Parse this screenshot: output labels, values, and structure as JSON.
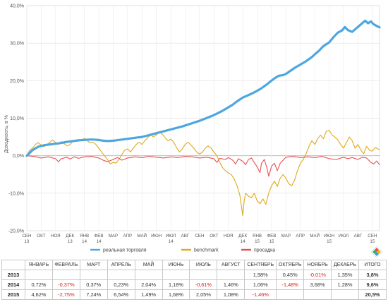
{
  "chart_data": {
    "type": "line",
    "title": "",
    "xlabel": "",
    "ylabel": "Доходность, в %",
    "ylim": [
      -20,
      40
    ],
    "y_ticks": [
      "40,0%",
      "30,0%",
      "20,0%",
      "10,0%",
      "0,0%",
      "-10,0%",
      "-20,0%"
    ],
    "y_tick_values": [
      40,
      30,
      20,
      10,
      0,
      -10,
      -20
    ],
    "grid": true,
    "legend_position": "bottom",
    "x_ticks": [
      {
        "label": "СЕН",
        "year": "13",
        "x": 0
      },
      {
        "label": "ОКТ",
        "year": "",
        "x": 1
      },
      {
        "label": "НОЯ",
        "year": "",
        "x": 2
      },
      {
        "label": "ДЕК",
        "year": "13",
        "x": 3
      },
      {
        "label": "ЯНВ",
        "year": "14",
        "x": 4
      },
      {
        "label": "ФЕВ",
        "year": "14",
        "x": 5
      },
      {
        "label": "МАР",
        "year": "",
        "x": 6
      },
      {
        "label": "АПР",
        "year": "",
        "x": 7
      },
      {
        "label": "МАЙ",
        "year": "",
        "x": 8
      },
      {
        "label": "ИЮН",
        "year": "",
        "x": 9
      },
      {
        "label": "ИЮЛ",
        "year": "14",
        "x": 10
      },
      {
        "label": "АВГ",
        "year": "",
        "x": 11
      },
      {
        "label": "СЕН",
        "year": "",
        "x": 12
      },
      {
        "label": "ОКТ",
        "year": "",
        "x": 13
      },
      {
        "label": "НОЯ",
        "year": "",
        "x": 14
      },
      {
        "label": "ДЕК",
        "year": "14",
        "x": 15
      },
      {
        "label": "ЯНВ",
        "year": "15",
        "x": 16
      },
      {
        "label": "ФЕВ",
        "year": "15",
        "x": 17
      },
      {
        "label": "МАР",
        "year": "",
        "x": 18
      },
      {
        "label": "АПР",
        "year": "",
        "x": 19
      },
      {
        "label": "МАЙ",
        "year": "",
        "x": 20
      },
      {
        "label": "ИЮН",
        "year": "15",
        "x": 21
      },
      {
        "label": "ИЮЛ",
        "year": "",
        "x": 22
      },
      {
        "label": "АВГ",
        "year": "",
        "x": 23
      },
      {
        "label": "СЕН",
        "year": "15",
        "x": 24
      }
    ],
    "x_range": [
      0,
      24.5
    ],
    "series": [
      {
        "name": "реальная торговля",
        "color": "#4da6e0",
        "width": 3.2,
        "points": [
          [
            0,
            0
          ],
          [
            0.4,
            1.5
          ],
          [
            0.8,
            2.4
          ],
          [
            1.2,
            2.8
          ],
          [
            1.6,
            3.0
          ],
          [
            2,
            3.2
          ],
          [
            2.4,
            3.4
          ],
          [
            2.8,
            3.7
          ],
          [
            3.2,
            3.9
          ],
          [
            3.6,
            4.1
          ],
          [
            4,
            4.2
          ],
          [
            4.3,
            4.3
          ],
          [
            4.6,
            4.3
          ],
          [
            5,
            4.2
          ],
          [
            5.3,
            4.0
          ],
          [
            5.6,
            3.9
          ],
          [
            6,
            4.0
          ],
          [
            6.4,
            4.2
          ],
          [
            6.8,
            4.4
          ],
          [
            7.2,
            4.6
          ],
          [
            7.6,
            4.8
          ],
          [
            8,
            5.0
          ],
          [
            8.4,
            5.4
          ],
          [
            8.8,
            5.8
          ],
          [
            9.2,
            6.2
          ],
          [
            9.6,
            6.6
          ],
          [
            10,
            7.0
          ],
          [
            10.4,
            7.4
          ],
          [
            10.8,
            7.8
          ],
          [
            11.2,
            8.3
          ],
          [
            11.6,
            8.8
          ],
          [
            12,
            9.3
          ],
          [
            12.4,
            9.9
          ],
          [
            12.8,
            10.5
          ],
          [
            13.2,
            11.2
          ],
          [
            13.6,
            12.0
          ],
          [
            14,
            12.9
          ],
          [
            14.3,
            13.6
          ],
          [
            14.6,
            14.5
          ],
          [
            15,
            15.5
          ],
          [
            15.3,
            16.0
          ],
          [
            15.6,
            16.5
          ],
          [
            16,
            17.3
          ],
          [
            16.3,
            18.0
          ],
          [
            16.6,
            18.8
          ],
          [
            17,
            20.0
          ],
          [
            17.2,
            20.6
          ],
          [
            17.5,
            21.3
          ],
          [
            17.8,
            21.5
          ],
          [
            18,
            21.8
          ],
          [
            18.3,
            22.6
          ],
          [
            18.6,
            23.4
          ],
          [
            19,
            24.3
          ],
          [
            19.4,
            25.2
          ],
          [
            19.8,
            26.3
          ],
          [
            20,
            27.0
          ],
          [
            20.3,
            28.0
          ],
          [
            20.6,
            29.2
          ],
          [
            21,
            30.2
          ],
          [
            21.3,
            31.6
          ],
          [
            21.6,
            32.8
          ],
          [
            21.9,
            33.4
          ],
          [
            22.1,
            34.3
          ],
          [
            22.3,
            33.5
          ],
          [
            22.6,
            33.0
          ],
          [
            22.9,
            34.0
          ],
          [
            23.2,
            35.0
          ],
          [
            23.5,
            36.0
          ],
          [
            23.7,
            35.3
          ],
          [
            23.9,
            35.8
          ],
          [
            24.1,
            35.0
          ],
          [
            24.3,
            34.6
          ],
          [
            24.5,
            34.2
          ]
        ]
      },
      {
        "name": "benchmark",
        "color": "#e0a81e",
        "width": 1.1,
        "points": [
          [
            0,
            0
          ],
          [
            0.2,
            1.5
          ],
          [
            0.4,
            2.0
          ],
          [
            0.6,
            3.0
          ],
          [
            0.8,
            3.5
          ],
          [
            1,
            2.8
          ],
          [
            1.2,
            2.4
          ],
          [
            1.4,
            3.0
          ],
          [
            1.6,
            3.6
          ],
          [
            1.8,
            4.2
          ],
          [
            2,
            3.5
          ],
          [
            2.2,
            3.0
          ],
          [
            2.4,
            3.8
          ],
          [
            2.6,
            3.2
          ],
          [
            2.8,
            2.6
          ],
          [
            3,
            3.0
          ],
          [
            3.2,
            3.8
          ],
          [
            3.4,
            4.2
          ],
          [
            3.6,
            4.0
          ],
          [
            3.8,
            4.2
          ],
          [
            4,
            4.6
          ],
          [
            4.2,
            4.0
          ],
          [
            4.4,
            3.4
          ],
          [
            4.6,
            3.6
          ],
          [
            4.8,
            3.0
          ],
          [
            5,
            2.0
          ],
          [
            5.2,
            1.0
          ],
          [
            5.4,
            0.0
          ],
          [
            5.6,
            -1.0
          ],
          [
            5.8,
            -2.2
          ],
          [
            6,
            -1.8
          ],
          [
            6.2,
            -2.0
          ],
          [
            6.4,
            -1.0
          ],
          [
            6.6,
            0.3
          ],
          [
            6.8,
            1.5
          ],
          [
            7,
            1.8
          ],
          [
            7.2,
            1.0
          ],
          [
            7.4,
            2.0
          ],
          [
            7.6,
            3.0
          ],
          [
            7.8,
            3.6
          ],
          [
            8,
            3.0
          ],
          [
            8.2,
            4.0
          ],
          [
            8.4,
            4.8
          ],
          [
            8.6,
            5.5
          ],
          [
            8.8,
            5.0
          ],
          [
            9,
            5.6
          ],
          [
            9.2,
            6.2
          ],
          [
            9.4,
            5.8
          ],
          [
            9.6,
            4.8
          ],
          [
            9.8,
            4.0
          ],
          [
            10,
            4.4
          ],
          [
            10.2,
            3.6
          ],
          [
            10.4,
            2.2
          ],
          [
            10.6,
            1.0
          ],
          [
            10.8,
            1.8
          ],
          [
            11,
            3.0
          ],
          [
            11.2,
            3.6
          ],
          [
            11.4,
            2.8
          ],
          [
            11.6,
            2.0
          ],
          [
            11.8,
            1.0
          ],
          [
            12,
            0.4
          ],
          [
            12.2,
            1.0
          ],
          [
            12.4,
            2.0
          ],
          [
            12.6,
            2.6
          ],
          [
            12.8,
            2.0
          ],
          [
            13,
            1.0
          ],
          [
            13.2,
            0.0
          ],
          [
            13.4,
            -1.8
          ],
          [
            13.6,
            -3.2
          ],
          [
            13.8,
            -4.0
          ],
          [
            14,
            -4.6
          ],
          [
            14.2,
            -5.0
          ],
          [
            14.4,
            -6.2
          ],
          [
            14.6,
            -8.0
          ],
          [
            14.8,
            -10.5
          ],
          [
            15,
            -16.0
          ],
          [
            15.1,
            -12.0
          ],
          [
            15.2,
            -10.0
          ],
          [
            15.4,
            -10.8
          ],
          [
            15.6,
            -11.2
          ],
          [
            15.8,
            -10.0
          ],
          [
            16,
            -12.0
          ],
          [
            16.2,
            -12.8
          ],
          [
            16.4,
            -11.5
          ],
          [
            16.6,
            -13.0
          ],
          [
            16.8,
            -10.0
          ],
          [
            17,
            -8.0
          ],
          [
            17.2,
            -6.8
          ],
          [
            17.4,
            -8.2
          ],
          [
            17.6,
            -6.0
          ],
          [
            17.8,
            -5.0
          ],
          [
            18,
            -6.0
          ],
          [
            18.2,
            -7.5
          ],
          [
            18.4,
            -8.0
          ],
          [
            18.6,
            -6.5
          ],
          [
            18.8,
            -4.0
          ],
          [
            19,
            -2.0
          ],
          [
            19.2,
            -1.0
          ],
          [
            19.4,
            0.5
          ],
          [
            19.6,
            2.5
          ],
          [
            19.8,
            4.0
          ],
          [
            20,
            3.0
          ],
          [
            20.2,
            4.5
          ],
          [
            20.4,
            5.5
          ],
          [
            20.6,
            4.5
          ],
          [
            20.8,
            6.5
          ],
          [
            21,
            6.8
          ],
          [
            21.2,
            5.5
          ],
          [
            21.4,
            5.0
          ],
          [
            21.6,
            4.2
          ],
          [
            21.8,
            3.0
          ],
          [
            22,
            2.0
          ],
          [
            22.2,
            3.5
          ],
          [
            22.4,
            5.0
          ],
          [
            22.6,
            4.0
          ],
          [
            22.8,
            2.0
          ],
          [
            23,
            3.0
          ],
          [
            23.2,
            1.5
          ],
          [
            23.4,
            0.5
          ],
          [
            23.6,
            2.5
          ],
          [
            23.8,
            1.5
          ],
          [
            24,
            1.2
          ],
          [
            24.2,
            2.2
          ],
          [
            24.5,
            1.6
          ]
        ]
      },
      {
        "name": "просадка",
        "color": "#e85050",
        "width": 1.1,
        "points": [
          [
            0,
            0
          ],
          [
            0.5,
            -0.2
          ],
          [
            1,
            -0.6
          ],
          [
            1.5,
            -0.3
          ],
          [
            2,
            -0.8
          ],
          [
            2.2,
            -1.6
          ],
          [
            2.4,
            -0.8
          ],
          [
            2.8,
            -0.4
          ],
          [
            3,
            -0.9
          ],
          [
            3.3,
            -0.3
          ],
          [
            3.6,
            -0.7
          ],
          [
            4,
            -0.3
          ],
          [
            4.5,
            -0.2
          ],
          [
            5,
            -0.6
          ],
          [
            5.3,
            -1.2
          ],
          [
            5.6,
            -1.6
          ],
          [
            6,
            -1.0
          ],
          [
            6.3,
            -0.5
          ],
          [
            6.6,
            -1.2
          ],
          [
            7,
            -0.6
          ],
          [
            7.5,
            -0.3
          ],
          [
            8,
            -0.5
          ],
          [
            8.5,
            -0.2
          ],
          [
            9,
            -0.4
          ],
          [
            9.5,
            -0.6
          ],
          [
            10,
            -0.3
          ],
          [
            10.5,
            -0.5
          ],
          [
            11,
            -0.2
          ],
          [
            11.5,
            -0.3
          ],
          [
            12,
            -0.6
          ],
          [
            12.5,
            -0.4
          ],
          [
            13,
            -0.8
          ],
          [
            13.2,
            -1.8
          ],
          [
            13.4,
            -0.7
          ],
          [
            13.8,
            -1.0
          ],
          [
            14,
            -0.5
          ],
          [
            14.3,
            -1.2
          ],
          [
            14.5,
            -2.2
          ],
          [
            14.7,
            -0.8
          ],
          [
            15,
            -1.5
          ],
          [
            15.2,
            -2.4
          ],
          [
            15.4,
            -1.0
          ],
          [
            15.6,
            -0.6
          ],
          [
            15.8,
            -1.8
          ],
          [
            16,
            -3.0
          ],
          [
            16.2,
            -4.5
          ],
          [
            16.3,
            -2.0
          ],
          [
            16.5,
            -1.0
          ],
          [
            16.7,
            -3.5
          ],
          [
            16.8,
            -5.5
          ],
          [
            17,
            -2.8
          ],
          [
            17.2,
            -2.0
          ],
          [
            17.4,
            -4.0
          ],
          [
            17.6,
            -2.0
          ],
          [
            17.8,
            -1.2
          ],
          [
            18,
            -0.4
          ],
          [
            18.5,
            -0.2
          ],
          [
            19,
            -0.5
          ],
          [
            19.5,
            -0.3
          ],
          [
            20,
            -0.5
          ],
          [
            20.5,
            -0.2
          ],
          [
            21,
            -0.8
          ],
          [
            21.5,
            -1.0
          ],
          [
            22,
            -0.4
          ],
          [
            22.3,
            -0.8
          ],
          [
            22.6,
            -0.5
          ],
          [
            23,
            -1.0
          ],
          [
            23.3,
            -0.4
          ],
          [
            23.6,
            -0.6
          ],
          [
            23.9,
            -1.8
          ],
          [
            24.1,
            -2.2
          ],
          [
            24.3,
            -1.4
          ],
          [
            24.5,
            -2.4
          ]
        ]
      }
    ]
  },
  "returns_table": {
    "headers": [
      "ЯНВАРЬ",
      "ФЕВРАЛЬ",
      "МАРТ",
      "АПРЕЛЬ",
      "МАЙ",
      "ИЮНЬ",
      "ИЮЛЬ",
      "АВГУСТ",
      "СЕНТЯБРЬ",
      "ОКТЯБРЬ",
      "НОЯБРЬ",
      "ДЕКАБРЬ",
      "ИТОГО"
    ],
    "rows": [
      {
        "year": "2013",
        "cells": [
          "",
          "",
          "",
          "",
          "",
          "",
          "",
          "",
          "1,98%",
          "0,45%",
          "-0,01%",
          "1,35%",
          "3,8%"
        ]
      },
      {
        "year": "2014",
        "cells": [
          "0,72%",
          "-0,37%",
          "0,37%",
          "0,23%",
          "2,04%",
          "1,18%",
          "-0,61%",
          "1,46%",
          "1,06%",
          "-1,48%",
          "3,68%",
          "1,28%",
          "9,6%"
        ]
      },
      {
        "year": "2015",
        "cells": [
          "4,62%",
          "-2,75%",
          "7,24%",
          "6,54%",
          "1,49%",
          "1,68%",
          "2,05%",
          "1,08%",
          "-1,46%",
          "",
          "",
          "",
          "20,5%"
        ]
      }
    ]
  },
  "logo": {
    "icon": "diamond-logo-icon",
    "colors": [
      "#e94e3c",
      "#f6b400",
      "#3aa0e0",
      "#2fb25d"
    ]
  }
}
